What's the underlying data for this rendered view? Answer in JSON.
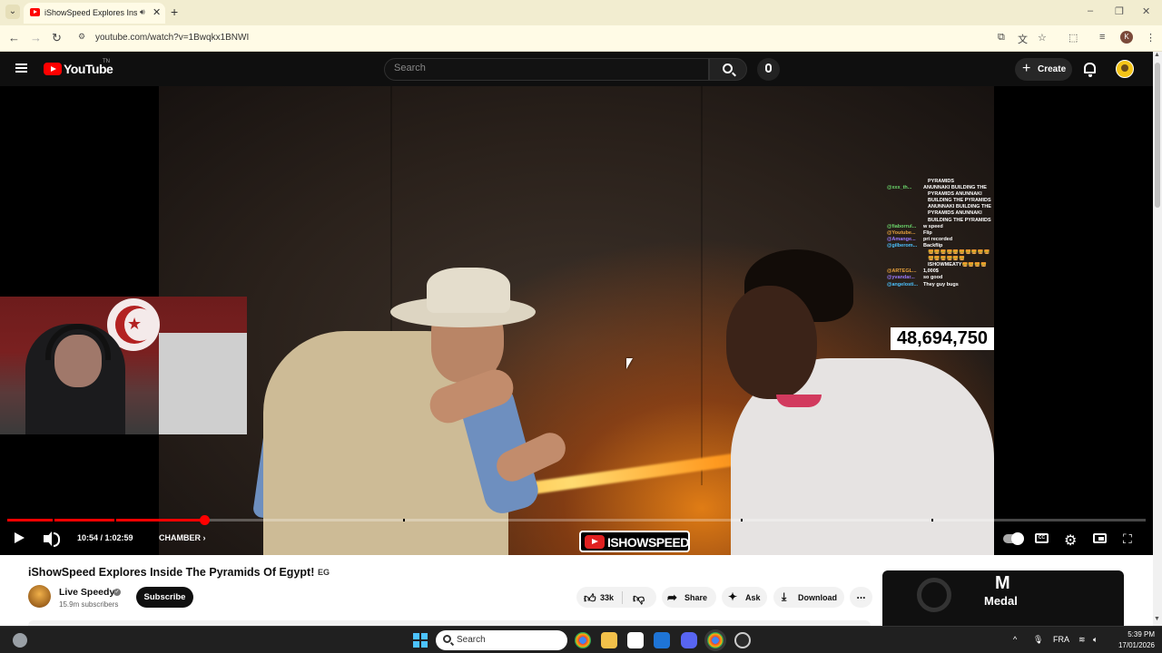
{
  "browser": {
    "tab_title": "iShowSpeed Explores Inside",
    "url": "youtube.com/watch?v=1Bwqkx1BNWI"
  },
  "header": {
    "logo_text": "YouTube",
    "logo_suffix": "TN",
    "search_placeholder": "Search",
    "create_label": "Create"
  },
  "player": {
    "time_display": "10:54 / 1:02:59",
    "chapter_label": "CHAMBER",
    "progress_fraction": 0.173,
    "counter_overlay": "48,694,7",
    "counter_overlay_tail": "50",
    "channel_watermark": "ISHOWSPEED",
    "chat_lines": [
      {
        "user": "",
        "msg": "PYRAMIDS"
      },
      {
        "user": "@xxx_th...",
        "msg": "ANUNNAKI BUILDING THE"
      },
      {
        "user": "",
        "msg": "PYRAMIDS ANUNNAKI"
      },
      {
        "user": "",
        "msg": "BUILDING THE PYRAMIDS"
      },
      {
        "user": "",
        "msg": "ANUNNAKI BUILDING THE"
      },
      {
        "user": "",
        "msg": "PYRAMIDS ANUNNAKI"
      },
      {
        "user": "",
        "msg": "BUILDING THE PYRAMIDS"
      },
      {
        "user": "@fiaborrul...",
        "msg": "w speed"
      },
      {
        "user": "@Youtube...",
        "msg": "Flip"
      },
      {
        "user": "@Amange...",
        "msg": "pri recorded"
      },
      {
        "user": "@gilberom...",
        "msg": "Backflip"
      },
      {
        "user": "",
        "msg": "🍔🍔🍔🍔🍔🍔🍔🍔🍔🍔"
      },
      {
        "user": "",
        "msg": "🍔🍔🍔🍔🍔🍔"
      },
      {
        "user": "",
        "msg": "ISHOWMEATY🍔🍔🍔🍔"
      },
      {
        "user": "@ARTEGL...",
        "msg": "1,000$"
      },
      {
        "user": "@yvandar...",
        "msg": "so good"
      },
      {
        "user": "@angelosti...",
        "msg": "They guy bugs"
      }
    ]
  },
  "video": {
    "title": "iShowSpeed Explores Inside The Pyramids Of Egypt!",
    "title_badge": "EG",
    "channel_name": "Live Speedy",
    "subscribers": "15.9m subscribers",
    "subscribe_label": "Subscribe",
    "like_count": "33k",
    "share_label": "Share",
    "ask_label": "Ask",
    "download_label": "Download",
    "more_label": "...",
    "sponsor_name": "Medal"
  },
  "taskbar": {
    "search_label": "Search",
    "language": "FRA",
    "time": "5:39 PM",
    "date": "17/01/2026"
  },
  "colors": {
    "accent": "#ff0000",
    "player_bg": "#000000",
    "page_bg": "#ffffff"
  }
}
